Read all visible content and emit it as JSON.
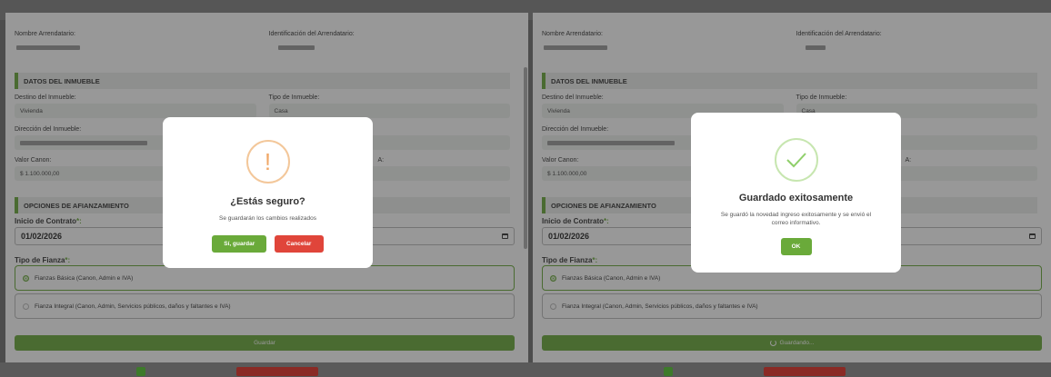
{
  "left": {
    "arrendatario": {
      "name_label": "Nombre Arrendatario:",
      "id_label": "Identificación del Arrendatario:"
    },
    "inmueble_section": "DATOS DEL INMUEBLE",
    "destino_label": "Destino del Inmueble:",
    "destino_value": "Vivienda",
    "tipo_label": "Tipo de Inmueble:",
    "tipo_value": "Casa",
    "direccion_label": "Dirección del Inmueble:",
    "valor_label": "Valor Canon:",
    "valor_value": "$ 1.100.000,00",
    "partial_label_right": "A:",
    "afianzamiento_section": "OPCIONES DE AFIANZAMIENTO",
    "inicio_label": "Inicio de Contrato",
    "inicio_value": "01/02/2026",
    "tipo_fianza_label": "Tipo de Fianza",
    "required_mark": "*:",
    "fianza_option1": "Fianzas Básica (Canon, Admin e IVA)",
    "fianza_option2": "Fianza Integral (Canon, Admin, Servicios públicos, daños y faltantes e IVA)",
    "save_button": "Guardar"
  },
  "left_modal": {
    "icon_glyph": "!",
    "title": "¿Estás seguro?",
    "text": "Se guardarán los cambios realizados",
    "confirm_button": "Sí, guardar",
    "cancel_button": "Cancelar"
  },
  "right": {
    "arrendatario": {
      "name_label": "Nombre Arrendatario:",
      "id_label": "Identificación del Arrendatario:"
    },
    "inmueble_section": "DATOS DEL INMUEBLE",
    "destino_label": "Destino del Inmueble:",
    "destino_value": "Vivienda",
    "tipo_label": "Tipo de Inmueble:",
    "tipo_value": "Casa",
    "direccion_label": "Dirección del Inmueble:",
    "valor_label": "Valor Canon:",
    "valor_value": "$ 1.100.000,00",
    "partial_label_right": "A:",
    "afianzamiento_section": "OPCIONES DE AFIANZAMIENTO",
    "inicio_label": "Inicio de Contrato",
    "inicio_value": "01/02/2026",
    "tipo_fianza_label": "Tipo de Fianza",
    "required_mark": "*:",
    "fianza_option1": "Fianzas Básica (Canon, Admin e IVA)",
    "fianza_option2": "Fianza Integral (Canon, Admin, Servicios públicos, daños y faltantes e IVA)",
    "saving_button": "Guardando..."
  },
  "right_modal": {
    "title": "Guardado exitosamente",
    "text": "Se guardó la novedad ingreso exitosamente y se envió el correo informativo.",
    "ok_button": "OK"
  },
  "colors": {
    "accent_green": "#6aaa3a",
    "danger_red": "#e0453a",
    "warning_orange": "#f0a868"
  }
}
